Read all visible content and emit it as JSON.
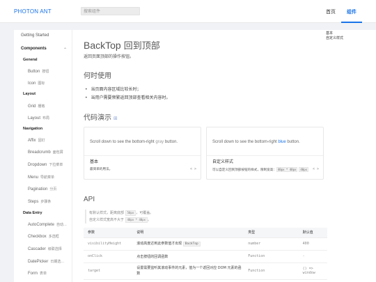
{
  "header": {
    "logo": "PHOTON ANT",
    "search_placeholder": "搜索组件",
    "nav_home": "首页",
    "nav_components": "组件"
  },
  "sidebar": {
    "getting_started": "Getting Started",
    "components": "Components",
    "general": "General",
    "button": {
      "en": "Button",
      "cn": "按钮"
    },
    "icon": {
      "en": "Icon",
      "cn": "图标"
    },
    "layout_group": "Layout",
    "grid": {
      "en": "Grid",
      "cn": "栅格"
    },
    "layout": {
      "en": "Layout",
      "cn": "布局"
    },
    "navigation_group": "Navigation",
    "affix": {
      "en": "Affix",
      "cn": "固钉"
    },
    "breadcrumb": {
      "en": "Breadcrumb",
      "cn": "面包屑"
    },
    "dropdown": {
      "en": "Dropdown",
      "cn": "下拉菜单"
    },
    "menu": {
      "en": "Menu",
      "cn": "导航菜单"
    },
    "pagination": {
      "en": "Pagination",
      "cn": "分页"
    },
    "steps": {
      "en": "Steps",
      "cn": "步骤条"
    },
    "data_entry_group": "Data Entry",
    "autocomplete": {
      "en": "AutoComplete",
      "cn": "自动..."
    },
    "checkbox": {
      "en": "Checkbox",
      "cn": "多选框"
    },
    "cascader": {
      "en": "Cascader",
      "cn": "级联选择"
    },
    "datepicker": {
      "en": "DatePicker",
      "cn": "日期选..."
    },
    "form": {
      "en": "Form",
      "cn": "表单"
    }
  },
  "main": {
    "title_en": "BackTop",
    "title_cn": "回到顶部",
    "subtitle": "返回页面顶部的操作按钮。",
    "when_to_use": "何时使用",
    "bullet_1": "当页面内容区域比较长时；",
    "bullet_2": "当用户需要频繁返回顶部查看相关内容时。",
    "demos": "代码演示"
  },
  "cards": {
    "basic": {
      "text_before": "Scroll down to see the bottom-right ",
      "highlight": "gray",
      "text_after": " button.",
      "title": "基本",
      "desc": "最简单的用法。",
      "code_icon": "< >"
    },
    "custom": {
      "text_before": "Scroll down to see the bottom-right ",
      "highlight": "blue",
      "text_after": " button.",
      "title": "自定义样式",
      "desc_before": "可以自定义回到顶部按钮的样式，限制宽高：",
      "chip_1": "40px * 40px",
      "chip_2": "40px",
      "code_icon": "< >"
    }
  },
  "api": {
    "title": "API",
    "note_line1_before": "有默认样式，距离底部 ",
    "note_chip_1": "50px",
    "note_line1_after": "，可覆盖。",
    "note_line2_before": "自定义样式宽高不大于 ",
    "note_chip_2": "40px * 40px",
    "note_line2_after": "。",
    "headers": [
      "参数",
      "说明",
      "类型",
      "默认值"
    ],
    "rows": [
      {
        "param": "visibilityHeight",
        "desc_before": "滚动高度达到此参数值才出现 ",
        "desc_code": "BackTop",
        "desc_after": "",
        "type": "number",
        "default": "400"
      },
      {
        "param": "onClick",
        "desc_before": "点击按钮的回调函数",
        "desc_code": "",
        "desc_after": "",
        "type": "Function",
        "default": "-"
      },
      {
        "param": "target",
        "desc_before": "设置需要监听其滚动事件的元素，值为一个返回对应 DOM 元素的函数",
        "desc_code": "",
        "desc_after": "",
        "type": "Function",
        "default": "() => window"
      }
    ]
  },
  "toc": {
    "basic": "基本",
    "custom": "自定义样式"
  },
  "colors": {
    "accent": "#1a73e8"
  }
}
